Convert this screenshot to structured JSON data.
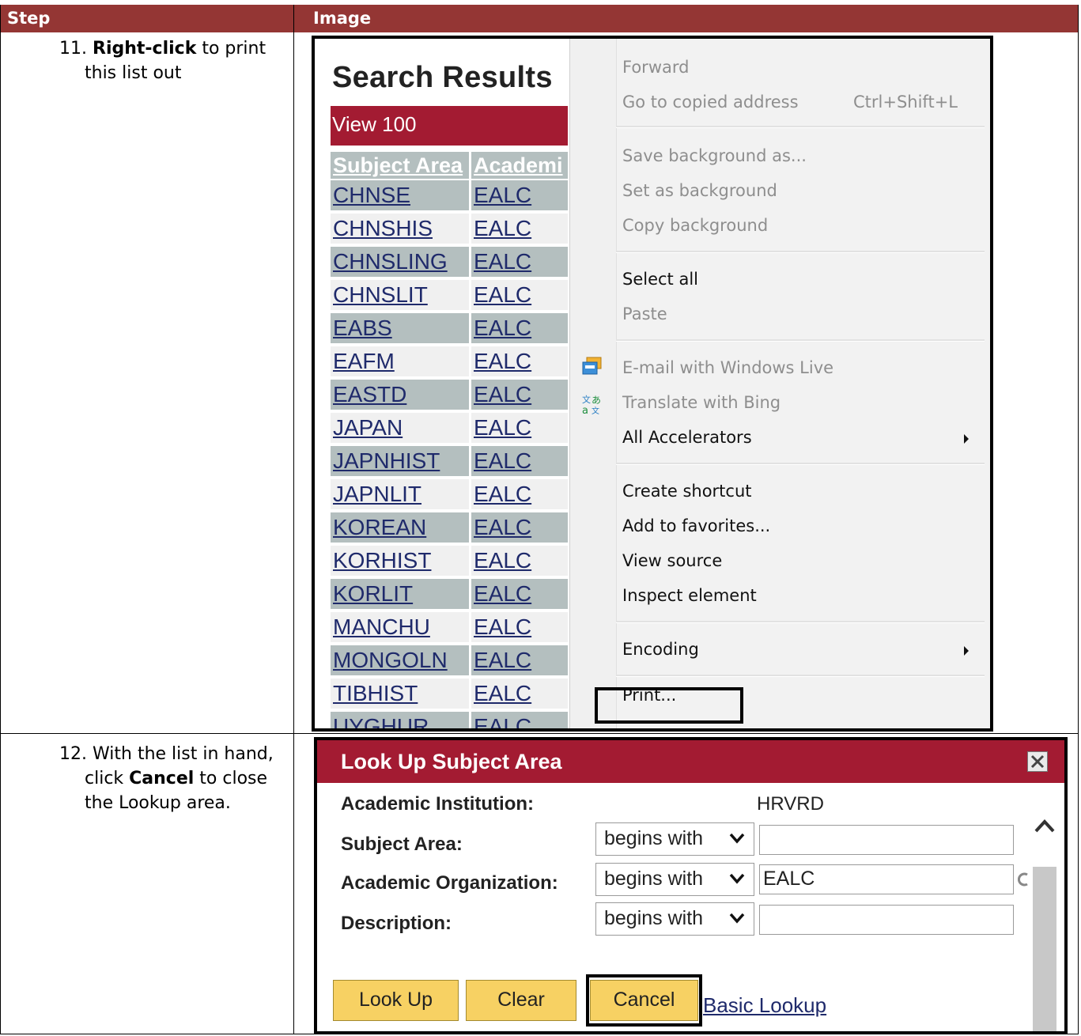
{
  "doc": {
    "col_step": "Step",
    "col_image": "Image",
    "step11": {
      "num": "11.",
      "bold": "Right-click",
      "rest1": " to print",
      "rest2": "this list out"
    },
    "step12": {
      "num": "12.",
      "line1": "With the list in hand,",
      "pre": "click ",
      "bold": "Cancel",
      "post": " to close",
      "line3": "the Lookup area."
    }
  },
  "results": {
    "title": "Search Results",
    "view_label": "View 100",
    "headers": [
      "Subject Area",
      "Academi"
    ],
    "rows": [
      [
        "CHNSE",
        "EALC"
      ],
      [
        "CHNSHIS",
        "EALC"
      ],
      [
        "CHNSLING",
        "EALC"
      ],
      [
        "CHNSLIT",
        "EALC"
      ],
      [
        "EABS",
        "EALC"
      ],
      [
        "EAFM",
        "EALC"
      ],
      [
        "EASTD",
        "EALC"
      ],
      [
        "JAPAN",
        "EALC"
      ],
      [
        "JAPNHIST",
        "EALC"
      ],
      [
        "JAPNLIT",
        "EALC"
      ],
      [
        "KOREAN",
        "EALC"
      ],
      [
        "KORHIST",
        "EALC"
      ],
      [
        "KORLIT",
        "EALC"
      ],
      [
        "MANCHU",
        "EALC"
      ],
      [
        "MONGOLN",
        "EALC"
      ],
      [
        "TIBHIST",
        "EALC"
      ],
      [
        "UYGHUR",
        "EALC"
      ]
    ]
  },
  "context_menu": {
    "items": [
      {
        "label": "Forward",
        "shortcut": "",
        "enabled": false
      },
      {
        "label": "Go to copied address",
        "shortcut": "Ctrl+Shift+L",
        "enabled": false
      },
      {
        "label": "Save background as...",
        "shortcut": "",
        "enabled": false
      },
      {
        "label": "Set as background",
        "shortcut": "",
        "enabled": false
      },
      {
        "label": "Copy background",
        "shortcut": "",
        "enabled": false
      },
      {
        "label": "Select all",
        "shortcut": "",
        "enabled": true
      },
      {
        "label": "Paste",
        "shortcut": "",
        "enabled": false
      },
      {
        "label": "E-mail with Windows Live",
        "shortcut": "",
        "enabled": false,
        "icon": "windows-live-icon"
      },
      {
        "label": "Translate with Bing",
        "shortcut": "",
        "enabled": false,
        "icon": "bing-translate-icon"
      },
      {
        "label": "All Accelerators",
        "shortcut": "",
        "enabled": true,
        "submenu": true
      },
      {
        "label": "Create shortcut",
        "shortcut": "",
        "enabled": true
      },
      {
        "label": "Add to favorites...",
        "shortcut": "",
        "enabled": true
      },
      {
        "label": "View source",
        "shortcut": "",
        "enabled": true
      },
      {
        "label": "Inspect element",
        "shortcut": "",
        "enabled": true
      },
      {
        "label": "Encoding",
        "shortcut": "",
        "enabled": true,
        "submenu": true
      },
      {
        "label": "Print...",
        "shortcut": "",
        "enabled": true
      }
    ]
  },
  "lookup": {
    "title": "Look Up Subject Area",
    "institution_label": "Academic Institution:",
    "institution_value": "HRVRD",
    "subject_label": "Subject Area:",
    "org_label": "Academic Organization:",
    "desc_label": "Description:",
    "operator": "begins with",
    "subject_value": "",
    "org_value": "EALC",
    "desc_value": "",
    "buttons": {
      "lookup": "Look Up",
      "clear": "Clear",
      "cancel": "Cancel"
    },
    "basic_link": "Basic Lookup"
  },
  "colors": {
    "doc_header": "#943634",
    "peoplesoft_red": "#a31b32",
    "button_yellow": "#f7d163"
  }
}
